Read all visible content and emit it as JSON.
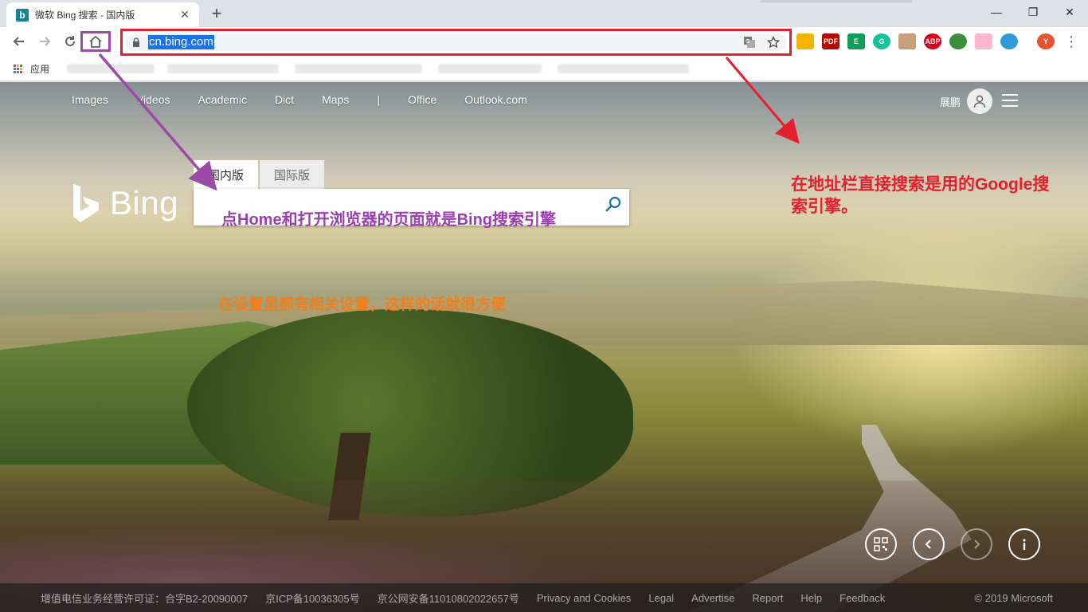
{
  "browser": {
    "tab": {
      "title": "微软 Bing 搜索 - 国内版",
      "favicon_letter": "b",
      "close": "✕"
    },
    "new_tab": "+",
    "window_controls": [
      "—",
      "❐",
      "✕"
    ],
    "address": {
      "url": "cn.bing.com"
    },
    "extensions": [
      {
        "label": "",
        "color": "#f4b400"
      },
      {
        "label": "PDF",
        "color": "#b30b00"
      },
      {
        "label": "E",
        "color": "#0f9d58"
      },
      {
        "label": "G",
        "color": "#15c39a"
      },
      {
        "label": "",
        "color": "#c7a07a"
      },
      {
        "label": "ABP",
        "color": "#d9001b"
      },
      {
        "label": "",
        "color": "#3a8f3a"
      },
      {
        "label": "",
        "color": "#ffb6d0"
      },
      {
        "label": "",
        "color": "#2f9ad8"
      },
      {
        "label": "Y",
        "color": "#e8532f"
      }
    ],
    "bookmarks": {
      "apps_label": "应用"
    }
  },
  "bing": {
    "nav_links": [
      "Images",
      "Videos",
      "Academic",
      "Dict",
      "Maps",
      "|",
      "Office",
      "Outlook.com"
    ],
    "user_name": "展鹏",
    "logo_text": "Bing",
    "scope_tabs": [
      "国内版",
      "国际版"
    ],
    "footer_links": [
      "增值电信业务经营许可证：合字B2-20090007",
      "京ICP备10036305号",
      "京公网安备11010802022657号",
      "Privacy and Cookies",
      "Legal",
      "Advertise",
      "Report",
      "Help",
      "Feedback"
    ],
    "copyright": "© 2019 Microsoft",
    "bottom_buttons": [
      "qr-code",
      "prev",
      "next",
      "info"
    ]
  },
  "annotations": {
    "purple": "点Home和打开浏览器的页面就是Bing搜索引擎",
    "red": "在地址栏直接搜索是用的Google搜索引擎。",
    "orange": "在设置里都有相关设置，这样的话就很方便",
    "colors": {
      "purple": "#9b4aa8",
      "red": "#e5202e",
      "orange": "#f07f1c"
    }
  }
}
